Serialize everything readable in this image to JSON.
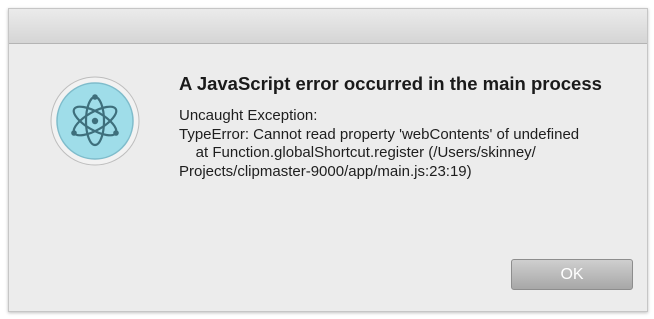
{
  "dialog": {
    "title": "A JavaScript error occurred in the main process",
    "message": "Uncaught Exception:\nTypeError: Cannot read property 'webContents' of undefined\n    at Function.globalShortcut.register (/Users/skinney/\nProjects/clipmaster-9000/app/main.js:23:19)",
    "ok_label": "OK",
    "icon": "electron-atom-icon"
  },
  "colors": {
    "icon_background": "#9fdde9",
    "icon_ring": "#f2f2f2",
    "icon_stroke": "#3e6f7c",
    "button": "#b5b5b5"
  }
}
